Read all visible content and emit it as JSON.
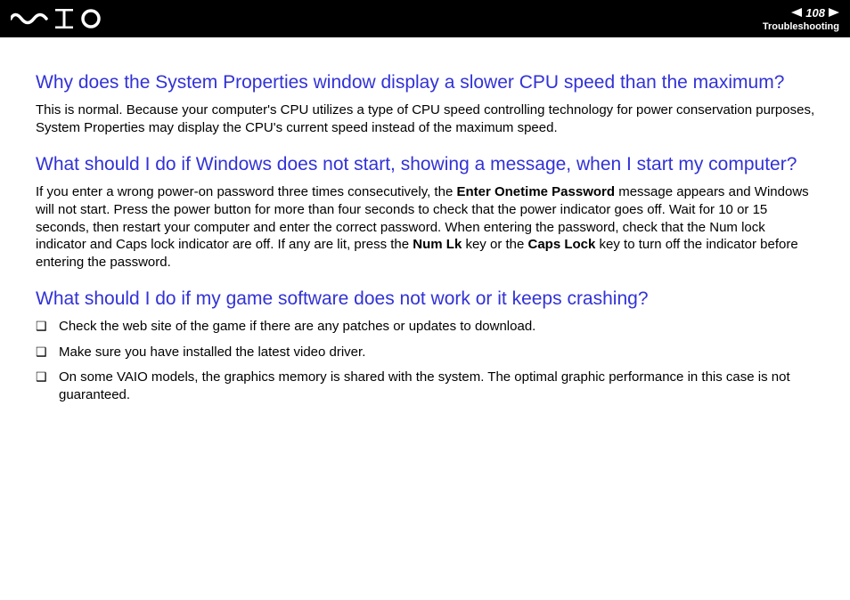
{
  "header": {
    "page_number": "108",
    "section": "Troubleshooting"
  },
  "content": {
    "q1": {
      "heading": "Why does the System Properties window display a slower CPU speed than the maximum?",
      "para": "This is normal. Because your computer's CPU utilizes a type of CPU speed controlling technology for power conservation purposes, System Properties may display the CPU's current speed instead of the maximum speed."
    },
    "q2": {
      "heading": "What should I do if Windows does not start, showing a message, when I start my computer?",
      "para_pre": "If you enter a wrong power-on password three times consecutively, the ",
      "bold1": "Enter Onetime Password",
      "para_mid": " message appears and Windows will not start. Press the power button for more than four seconds to check that the power indicator goes off. Wait for 10 or 15 seconds, then restart your computer and enter the correct password. When entering the password, check that the Num lock indicator and Caps lock indicator are off. If any are lit, press the ",
      "bold2": "Num Lk",
      "para_mid2": " key or the ",
      "bold3": "Caps Lock",
      "para_post": " key to turn off the indicator before entering the password."
    },
    "q3": {
      "heading": "What should I do if my game software does not work or it keeps crashing?",
      "bullets": [
        "Check the web site of the game if there are any patches or updates to download.",
        "Make sure you have installed the latest video driver.",
        "On some VAIO models, the graphics memory is shared with the system. The optimal graphic performance in this case is not guaranteed."
      ]
    }
  }
}
